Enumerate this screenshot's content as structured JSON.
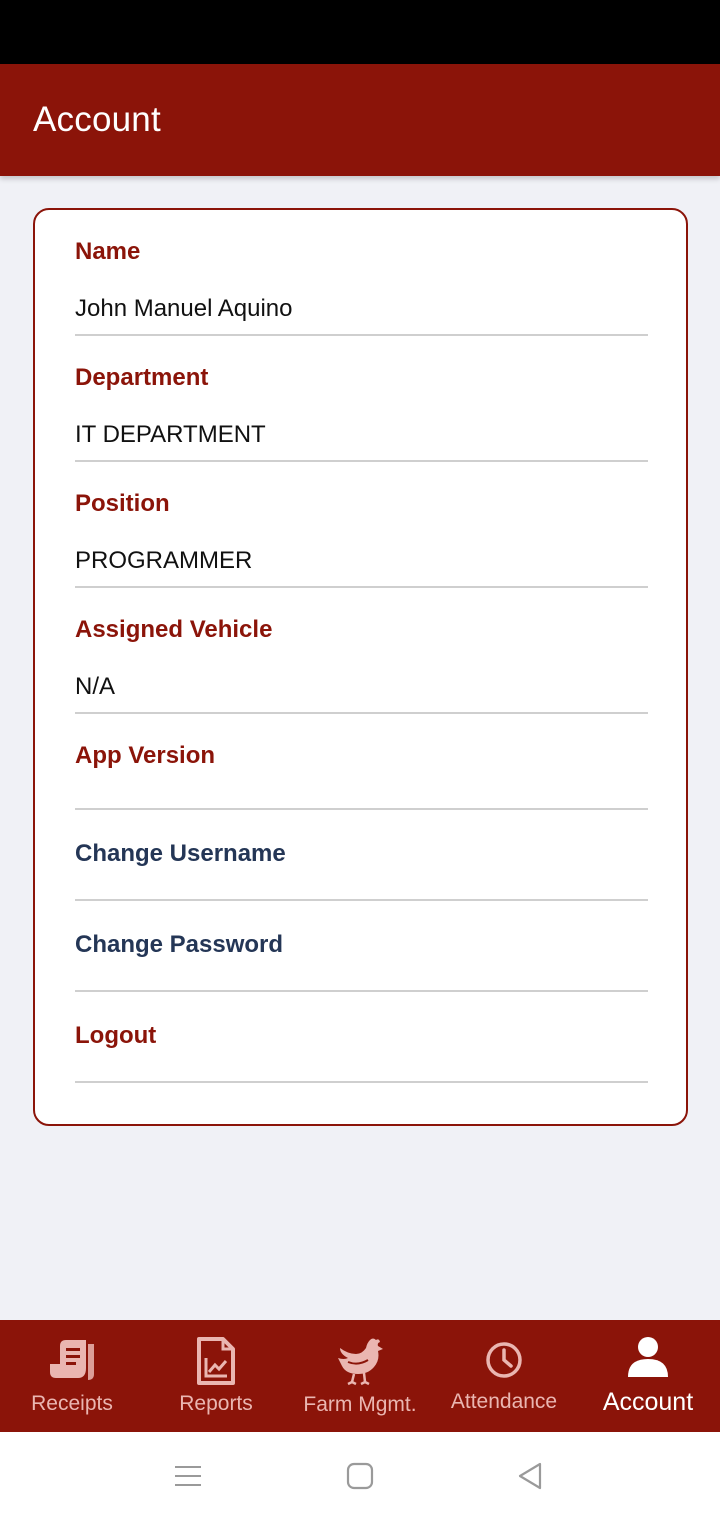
{
  "header": {
    "title": "Account"
  },
  "account": {
    "fields": [
      {
        "label": "Name",
        "value": "John Manuel Aquino"
      },
      {
        "label": "Department",
        "value": "IT DEPARTMENT"
      },
      {
        "label": "Position",
        "value": "PROGRAMMER"
      },
      {
        "label": "Assigned Vehicle",
        "value": "N/A"
      },
      {
        "label": "App Version",
        "value": ""
      }
    ],
    "actions": {
      "change_username": "Change Username",
      "change_password": "Change Password",
      "logout": "Logout"
    }
  },
  "bottom_nav": {
    "items": [
      {
        "label": "Receipts",
        "icon": "receipt-icon"
      },
      {
        "label": "Reports",
        "icon": "report-icon"
      },
      {
        "label": "Farm Mgmt.",
        "icon": "chicken-icon"
      },
      {
        "label": "Attendance",
        "icon": "clock-icon"
      },
      {
        "label": "Account",
        "icon": "user-icon",
        "active": true
      }
    ]
  },
  "colors": {
    "primary": "#8b1409",
    "navy": "#243656",
    "background": "#f0f1f6",
    "inactive_nav": "#eab6b1"
  },
  "system_nav": {
    "icons": [
      "menu-icon",
      "home-icon",
      "back-icon"
    ]
  }
}
